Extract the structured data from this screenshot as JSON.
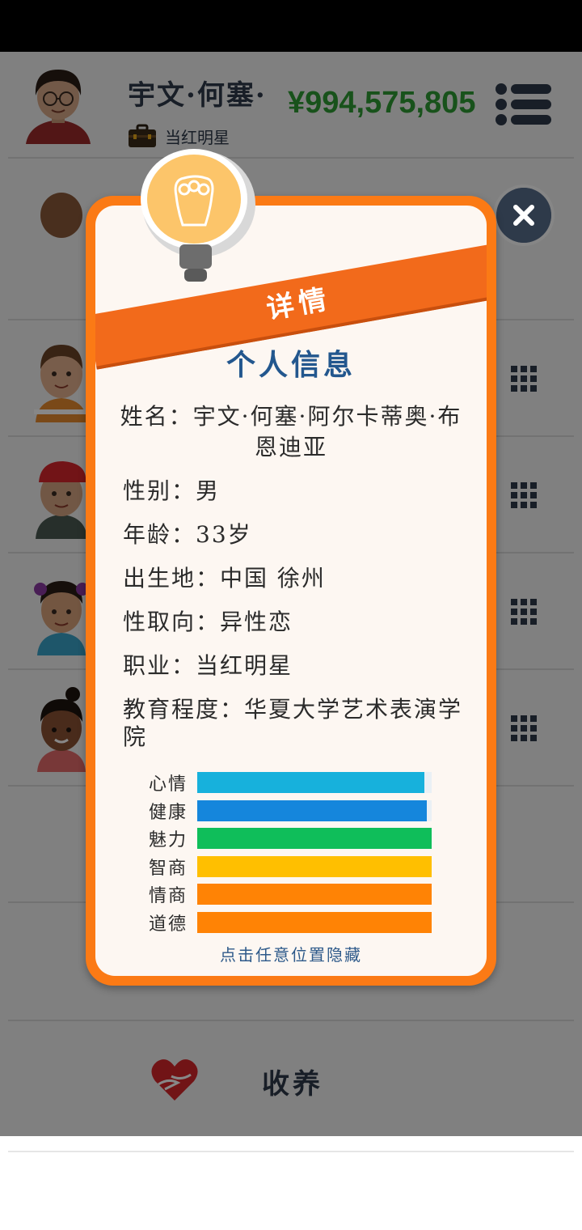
{
  "header": {
    "player_name": "宇文·何塞·",
    "job": "当红明星",
    "money": "¥994,575,805"
  },
  "adopt": {
    "label": "收养"
  },
  "dialog": {
    "ribbon_title": "详情",
    "section_title": "个人信息",
    "name_line": "姓名：宇文·何塞·阿尔卡蒂奥·布恩迪亚",
    "gender": "性别：男",
    "age": "年龄：33岁",
    "birthplace": "出生地：中国 徐州",
    "orientation": "性取向：异性恋",
    "occupation": "职业：当红明星",
    "education": "教育程度：华夏大学艺术表演学院",
    "stats": [
      {
        "label": "心情",
        "value": 0.97,
        "color": "#17b1dc"
      },
      {
        "label": "健康",
        "value": 0.98,
        "color": "#1586dc"
      },
      {
        "label": "魅力",
        "value": 1.0,
        "color": "#0fbe5a"
      },
      {
        "label": "智商",
        "value": 1.0,
        "color": "#ffbf00"
      },
      {
        "label": "情商",
        "value": 1.0,
        "color": "#ff8305"
      },
      {
        "label": "道德",
        "value": 1.0,
        "color": "#ff8305"
      }
    ],
    "hint": "点击任意位置隐藏"
  }
}
